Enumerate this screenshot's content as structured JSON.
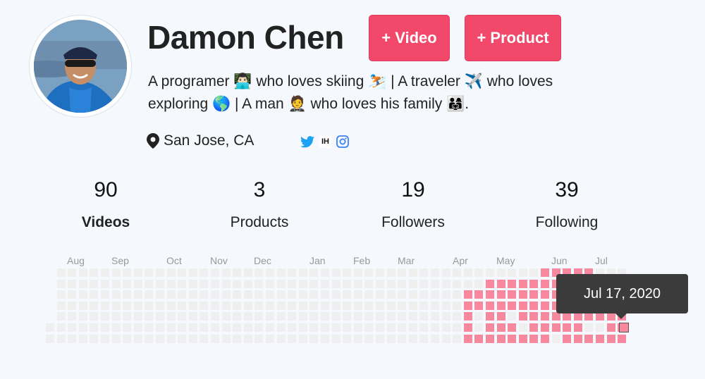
{
  "profile": {
    "name": "Damon Chen",
    "bio_line1": "A programer 👨🏻‍💻 who loves skiing ⛷️ | A traveler ✈️ who loves",
    "bio_line2": "exploring 🌎 | A man 🤵 who loves his family 👨‍👩‍👧.",
    "location": "San Jose, CA",
    "ih_label": "IH"
  },
  "actions": {
    "video_label": "+ Video",
    "product_label": "+ Product"
  },
  "stats": [
    {
      "value": "90",
      "label": "Videos"
    },
    {
      "value": "3",
      "label": "Products"
    },
    {
      "value": "19",
      "label": "Followers"
    },
    {
      "value": "39",
      "label": "Following"
    }
  ],
  "calendar": {
    "months": [
      "Aug",
      "Sep",
      "Oct",
      "Nov",
      "Dec",
      "Jan",
      "Feb",
      "Mar",
      "Apr",
      "May",
      "Jun",
      "Jul"
    ],
    "tooltip": "Jul 17, 2020",
    "active_color": "#f7889d",
    "empty_color": "#efefef"
  },
  "colors": {
    "accent": "#f2496b",
    "twitter": "#1da1f2",
    "instagram": "#3b82f6"
  }
}
